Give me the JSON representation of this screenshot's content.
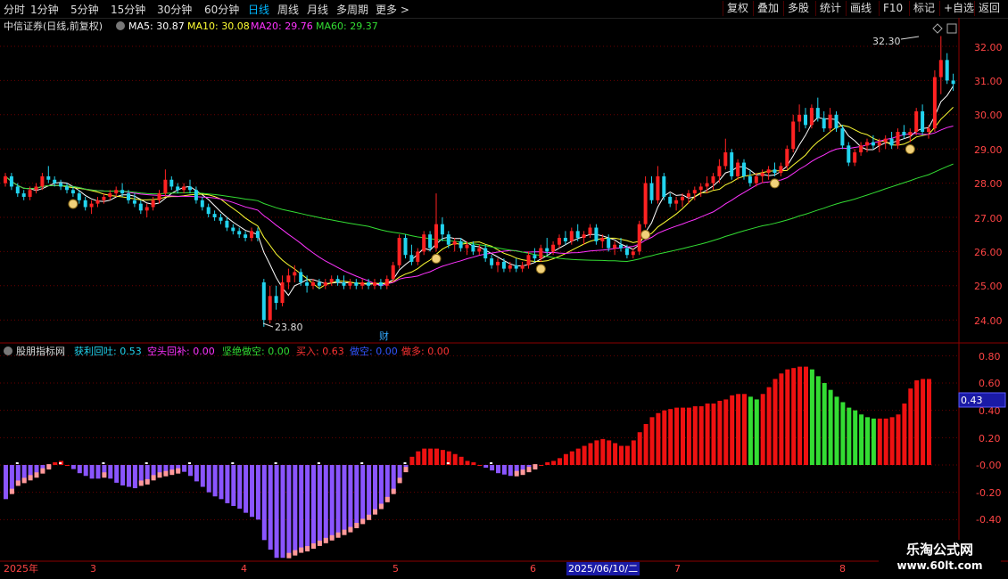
{
  "toolbar": {
    "periods": [
      {
        "label": "分时",
        "active": false
      },
      {
        "label": "1分钟",
        "active": false
      },
      {
        "label": "5分钟",
        "active": false
      },
      {
        "label": "15分钟",
        "active": false
      },
      {
        "label": "30分钟",
        "active": false
      },
      {
        "label": "60分钟",
        "active": false
      },
      {
        "label": "日线",
        "active": true
      },
      {
        "label": "周线",
        "active": false
      },
      {
        "label": "月线",
        "active": false
      },
      {
        "label": "多周期",
        "active": false
      },
      {
        "label": "更多 >",
        "active": false
      }
    ],
    "actions": [
      "复权",
      "叠加",
      "多股",
      "统计",
      "画线",
      "F10",
      "标记",
      "+自选",
      "返回"
    ]
  },
  "main_panel": {
    "stock_label": "中信证券(日线,前复权)",
    "ma_legend": [
      {
        "text": "MA5: 30.87",
        "color": "#ffffff"
      },
      {
        "text": "MA10: 30.08",
        "color": "#ffff33"
      },
      {
        "text": "MA20: 29.76",
        "color": "#ff33ff"
      },
      {
        "text": "MA60: 29.37",
        "color": "#33dd33"
      }
    ],
    "high_label": "32.30",
    "low_label": "23.80",
    "cai_label": "财",
    "y_ticks": [
      "32.00",
      "31.00",
      "30.00",
      "29.00",
      "28.00",
      "27.00",
      "26.00",
      "25.00",
      "24.00"
    ]
  },
  "indicator_panel": {
    "name": "股朋指标网",
    "legend": [
      {
        "text": "获利回吐: 0.53",
        "color": "#22d3ee"
      },
      {
        "text": "空头回补: 0.00",
        "color": "#ff33ff"
      },
      {
        "text": "坚绝做空: 0.00",
        "color": "#33dd33"
      },
      {
        "text": "买入: 0.63",
        "color": "#ff3333"
      },
      {
        "text": "做空: 0.00",
        "color": "#3355ff"
      },
      {
        "text": "做多: 0.00",
        "color": "#ff3333"
      }
    ],
    "y_ticks": [
      "0.80",
      "0.60",
      "0.40",
      "0.20",
      "-0.00",
      "-0.20",
      "-0.40"
    ],
    "current_value_badge": "0.43"
  },
  "date_axis": {
    "labels": [
      "2025年",
      "3",
      "4",
      "5",
      "6",
      "7",
      "8"
    ],
    "highlight": "2025/06/10/二"
  },
  "watermark": {
    "title": "乐淘公式网",
    "url": "www.60lt.com"
  },
  "chart_data": {
    "type": "candlestick",
    "price_range": [
      23.5,
      32.5
    ],
    "price_candles_ohlc": [
      [
        28.0,
        28.3,
        27.9,
        28.2
      ],
      [
        28.2,
        28.3,
        27.8,
        27.9
      ],
      [
        27.9,
        28.0,
        27.6,
        27.7
      ],
      [
        27.7,
        27.8,
        27.5,
        27.6
      ],
      [
        27.6,
        27.9,
        27.5,
        27.8
      ],
      [
        27.8,
        28.0,
        27.7,
        27.9
      ],
      [
        27.9,
        28.3,
        27.8,
        28.2
      ],
      [
        28.2,
        28.5,
        28.0,
        28.1
      ],
      [
        28.1,
        28.2,
        27.9,
        28.0
      ],
      [
        28.0,
        28.1,
        27.8,
        27.9
      ],
      [
        27.9,
        28.0,
        27.7,
        27.8
      ],
      [
        27.8,
        27.9,
        27.6,
        27.7
      ],
      [
        27.7,
        27.8,
        27.4,
        27.5
      ],
      [
        27.5,
        27.6,
        27.2,
        27.3
      ],
      [
        27.3,
        27.5,
        27.1,
        27.4
      ],
      [
        27.4,
        27.6,
        27.3,
        27.5
      ],
      [
        27.5,
        27.7,
        27.4,
        27.6
      ],
      [
        27.6,
        27.8,
        27.5,
        27.7
      ],
      [
        27.7,
        27.9,
        27.6,
        27.8
      ],
      [
        27.8,
        28.0,
        27.6,
        27.7
      ],
      [
        27.7,
        27.8,
        27.4,
        27.5
      ],
      [
        27.5,
        27.7,
        27.3,
        27.4
      ],
      [
        27.4,
        27.5,
        27.1,
        27.2
      ],
      [
        27.2,
        27.4,
        27.0,
        27.3
      ],
      [
        27.3,
        27.6,
        27.2,
        27.5
      ],
      [
        27.5,
        27.8,
        27.4,
        27.7
      ],
      [
        27.7,
        28.4,
        27.6,
        28.1
      ],
      [
        28.1,
        28.2,
        27.8,
        27.9
      ],
      [
        27.9,
        28.0,
        27.7,
        27.8
      ],
      [
        27.8,
        28.0,
        27.7,
        27.9
      ],
      [
        27.9,
        28.1,
        27.7,
        27.8
      ],
      [
        27.8,
        27.9,
        27.4,
        27.5
      ],
      [
        27.5,
        27.6,
        27.2,
        27.3
      ],
      [
        27.3,
        27.4,
        27.0,
        27.1
      ],
      [
        27.1,
        27.2,
        26.9,
        27.0
      ],
      [
        27.0,
        27.1,
        26.8,
        26.9
      ],
      [
        26.9,
        27.0,
        26.6,
        26.7
      ],
      [
        26.7,
        26.8,
        26.5,
        26.6
      ],
      [
        26.6,
        26.7,
        26.4,
        26.5
      ],
      [
        26.5,
        26.6,
        26.3,
        26.4
      ],
      [
        26.4,
        26.7,
        26.3,
        26.6
      ],
      [
        26.6,
        26.7,
        26.3,
        26.4
      ],
      [
        25.1,
        25.2,
        23.8,
        24.0
      ],
      [
        24.0,
        25.0,
        23.9,
        24.7
      ],
      [
        24.7,
        25.0,
        24.3,
        24.5
      ],
      [
        24.5,
        25.3,
        24.4,
        25.1
      ],
      [
        25.1,
        25.5,
        24.9,
        25.3
      ],
      [
        25.3,
        25.6,
        25.1,
        25.4
      ],
      [
        25.4,
        25.5,
        25.0,
        25.1
      ],
      [
        25.1,
        25.3,
        24.8,
        25.0
      ],
      [
        25.0,
        25.2,
        24.9,
        25.1
      ],
      [
        25.1,
        25.2,
        24.9,
        25.0
      ],
      [
        25.0,
        25.2,
        24.9,
        25.1
      ],
      [
        25.1,
        25.3,
        25.0,
        25.2
      ],
      [
        25.2,
        25.3,
        25.0,
        25.1
      ],
      [
        25.1,
        25.3,
        24.9,
        25.0
      ],
      [
        25.0,
        25.2,
        24.9,
        25.1
      ],
      [
        25.1,
        25.2,
        24.9,
        25.0
      ],
      [
        25.0,
        25.2,
        24.9,
        25.1
      ],
      [
        25.1,
        25.2,
        24.9,
        25.0
      ],
      [
        25.0,
        25.2,
        24.9,
        25.1
      ],
      [
        25.1,
        25.2,
        24.9,
        25.0
      ],
      [
        25.0,
        25.3,
        24.9,
        25.2
      ],
      [
        25.2,
        25.7,
        25.1,
        25.6
      ],
      [
        25.6,
        26.5,
        25.5,
        26.4
      ],
      [
        26.4,
        26.5,
        25.8,
        25.9
      ],
      [
        25.9,
        26.2,
        25.6,
        25.7
      ],
      [
        25.7,
        26.1,
        25.6,
        26.0
      ],
      [
        26.0,
        26.6,
        25.9,
        26.5
      ],
      [
        26.5,
        26.6,
        26.0,
        26.1
      ],
      [
        26.1,
        27.7,
        26.0,
        26.8
      ],
      [
        26.8,
        27.0,
        26.3,
        26.5
      ],
      [
        26.5,
        26.6,
        26.1,
        26.2
      ],
      [
        26.2,
        26.4,
        26.0,
        26.3
      ],
      [
        26.3,
        26.4,
        26.0,
        26.1
      ],
      [
        26.1,
        26.3,
        25.9,
        26.2
      ],
      [
        26.2,
        26.3,
        25.9,
        26.0
      ],
      [
        26.0,
        26.2,
        25.9,
        26.1
      ],
      [
        26.1,
        26.2,
        25.7,
        25.8
      ],
      [
        25.8,
        25.9,
        25.5,
        25.6
      ],
      [
        25.6,
        25.8,
        25.4,
        25.7
      ],
      [
        25.7,
        25.8,
        25.4,
        25.5
      ],
      [
        25.5,
        25.7,
        25.4,
        25.6
      ],
      [
        25.6,
        25.8,
        25.4,
        25.5
      ],
      [
        25.5,
        25.7,
        25.4,
        25.6
      ],
      [
        25.6,
        26.0,
        25.5,
        25.9
      ],
      [
        25.9,
        26.1,
        25.7,
        25.8
      ],
      [
        25.8,
        26.2,
        25.7,
        26.1
      ],
      [
        26.1,
        26.4,
        25.9,
        26.0
      ],
      [
        26.0,
        26.3,
        25.9,
        26.2
      ],
      [
        26.2,
        26.5,
        26.1,
        26.4
      ],
      [
        26.4,
        26.6,
        26.2,
        26.3
      ],
      [
        26.3,
        26.7,
        26.2,
        26.6
      ],
      [
        26.6,
        26.8,
        26.3,
        26.4
      ],
      [
        26.4,
        26.6,
        26.2,
        26.5
      ],
      [
        26.5,
        26.8,
        26.4,
        26.7
      ],
      [
        26.7,
        26.8,
        26.2,
        26.3
      ],
      [
        26.3,
        26.5,
        26.1,
        26.4
      ],
      [
        26.4,
        26.5,
        26.0,
        26.1
      ],
      [
        26.1,
        26.3,
        25.9,
        26.2
      ],
      [
        26.2,
        26.4,
        26.0,
        26.1
      ],
      [
        26.1,
        26.2,
        25.8,
        25.9
      ],
      [
        25.9,
        26.1,
        25.8,
        26.0
      ],
      [
        26.0,
        26.9,
        25.9,
        26.8
      ],
      [
        26.8,
        28.2,
        26.7,
        28.0
      ],
      [
        28.0,
        28.2,
        27.4,
        27.5
      ],
      [
        27.5,
        28.5,
        27.4,
        28.2
      ],
      [
        28.2,
        28.3,
        27.5,
        27.6
      ],
      [
        27.6,
        27.7,
        27.3,
        27.4
      ],
      [
        27.4,
        27.6,
        27.2,
        27.5
      ],
      [
        27.5,
        27.7,
        27.3,
        27.6
      ],
      [
        27.6,
        27.8,
        27.4,
        27.7
      ],
      [
        27.7,
        27.9,
        27.5,
        27.8
      ],
      [
        27.8,
        28.0,
        27.6,
        27.9
      ],
      [
        27.9,
        28.2,
        27.7,
        28.0
      ],
      [
        28.0,
        28.3,
        27.8,
        28.2
      ],
      [
        28.2,
        28.7,
        28.0,
        28.5
      ],
      [
        28.5,
        29.3,
        28.4,
        28.9
      ],
      [
        28.9,
        29.0,
        28.1,
        28.2
      ],
      [
        28.2,
        28.7,
        28.1,
        28.6
      ],
      [
        28.6,
        28.7,
        28.1,
        28.2
      ],
      [
        28.2,
        28.4,
        27.9,
        28.0
      ],
      [
        28.0,
        28.3,
        27.9,
        28.2
      ],
      [
        28.2,
        28.4,
        28.0,
        28.3
      ],
      [
        28.3,
        28.5,
        28.1,
        28.4
      ],
      [
        28.4,
        28.6,
        28.2,
        28.3
      ],
      [
        28.3,
        28.6,
        28.2,
        28.5
      ],
      [
        28.5,
        29.1,
        28.4,
        29.0
      ],
      [
        29.0,
        30.0,
        28.9,
        29.8
      ],
      [
        29.8,
        30.3,
        29.5,
        30.0
      ],
      [
        30.0,
        30.2,
        29.6,
        29.7
      ],
      [
        29.7,
        30.3,
        29.6,
        30.2
      ],
      [
        30.2,
        30.5,
        29.8,
        29.9
      ],
      [
        29.9,
        30.1,
        29.5,
        29.6
      ],
      [
        29.6,
        30.2,
        29.5,
        30.0
      ],
      [
        30.0,
        30.1,
        29.5,
        29.6
      ],
      [
        29.6,
        29.7,
        29.0,
        29.1
      ],
      [
        29.1,
        29.2,
        28.5,
        28.6
      ],
      [
        28.6,
        29.0,
        28.5,
        28.9
      ],
      [
        28.9,
        29.2,
        28.8,
        29.1
      ],
      [
        29.1,
        29.3,
        28.9,
        29.2
      ],
      [
        29.2,
        29.4,
        29.0,
        29.1
      ],
      [
        29.1,
        29.3,
        28.9,
        29.2
      ],
      [
        29.2,
        29.4,
        29.0,
        29.3
      ],
      [
        29.3,
        29.5,
        29.0,
        29.1
      ],
      [
        29.1,
        29.6,
        29.0,
        29.5
      ],
      [
        29.5,
        29.7,
        29.3,
        29.4
      ],
      [
        29.4,
        29.6,
        29.2,
        29.5
      ],
      [
        29.5,
        30.2,
        29.4,
        30.1
      ],
      [
        30.1,
        30.3,
        29.4,
        29.5
      ],
      [
        29.5,
        29.7,
        29.3,
        29.6
      ],
      [
        29.6,
        31.3,
        29.5,
        31.1
      ],
      [
        31.1,
        32.3,
        30.6,
        31.6
      ],
      [
        31.6,
        31.8,
        30.9,
        31.0
      ],
      [
        31.0,
        31.2,
        30.7,
        30.9
      ]
    ],
    "money_bag_markers_at_index": [
      11,
      70,
      87,
      104,
      125,
      147
    ],
    "indicator_range": [
      -0.5,
      0.9
    ],
    "indicator_bars": [
      -0.25,
      -0.2,
      -0.14,
      -0.12,
      -0.1,
      -0.08,
      -0.05,
      -0.02,
      0.02,
      0.03,
      0.0,
      -0.03,
      -0.06,
      -0.08,
      -0.1,
      -0.1,
      -0.08,
      -0.1,
      -0.13,
      -0.15,
      -0.16,
      -0.17,
      -0.14,
      -0.13,
      -0.1,
      -0.08,
      -0.07,
      -0.06,
      -0.05,
      -0.05,
      -0.08,
      -0.12,
      -0.16,
      -0.2,
      -0.23,
      -0.25,
      -0.28,
      -0.3,
      -0.32,
      -0.35,
      -0.38,
      -0.4,
      -0.55,
      -0.62,
      -0.68,
      -0.68,
      -0.67,
      -0.65,
      -0.63,
      -0.62,
      -0.6,
      -0.58,
      -0.56,
      -0.54,
      -0.52,
      -0.5,
      -0.48,
      -0.45,
      -0.42,
      -0.39,
      -0.35,
      -0.31,
      -0.26,
      -0.2,
      -0.12,
      -0.04,
      0.06,
      0.1,
      0.12,
      0.12,
      0.12,
      0.11,
      0.1,
      0.08,
      0.06,
      0.03,
      0.02,
      0.0,
      -0.02,
      -0.04,
      -0.06,
      -0.07,
      -0.08,
      -0.07,
      -0.06,
      -0.04,
      -0.02,
      0.0,
      0.02,
      0.03,
      0.05,
      0.08,
      0.1,
      0.12,
      0.14,
      0.16,
      0.18,
      0.19,
      0.18,
      0.16,
      0.14,
      0.14,
      0.18,
      0.24,
      0.3,
      0.35,
      0.38,
      0.4,
      0.41,
      0.42,
      0.42,
      0.42,
      0.43,
      0.43,
      0.45,
      0.45,
      0.47,
      0.48,
      0.51,
      0.52,
      0.52,
      0.5,
      0.48,
      0.52,
      0.57,
      0.63,
      0.67,
      0.7,
      0.71,
      0.72,
      0.72,
      0.7,
      0.65,
      0.6,
      0.55,
      0.5,
      0.46,
      0.42,
      0.4,
      0.37,
      0.35,
      0.34,
      0.34,
      0.34,
      0.35,
      0.37,
      0.45,
      0.56,
      0.62,
      0.63,
      0.63
    ]
  }
}
